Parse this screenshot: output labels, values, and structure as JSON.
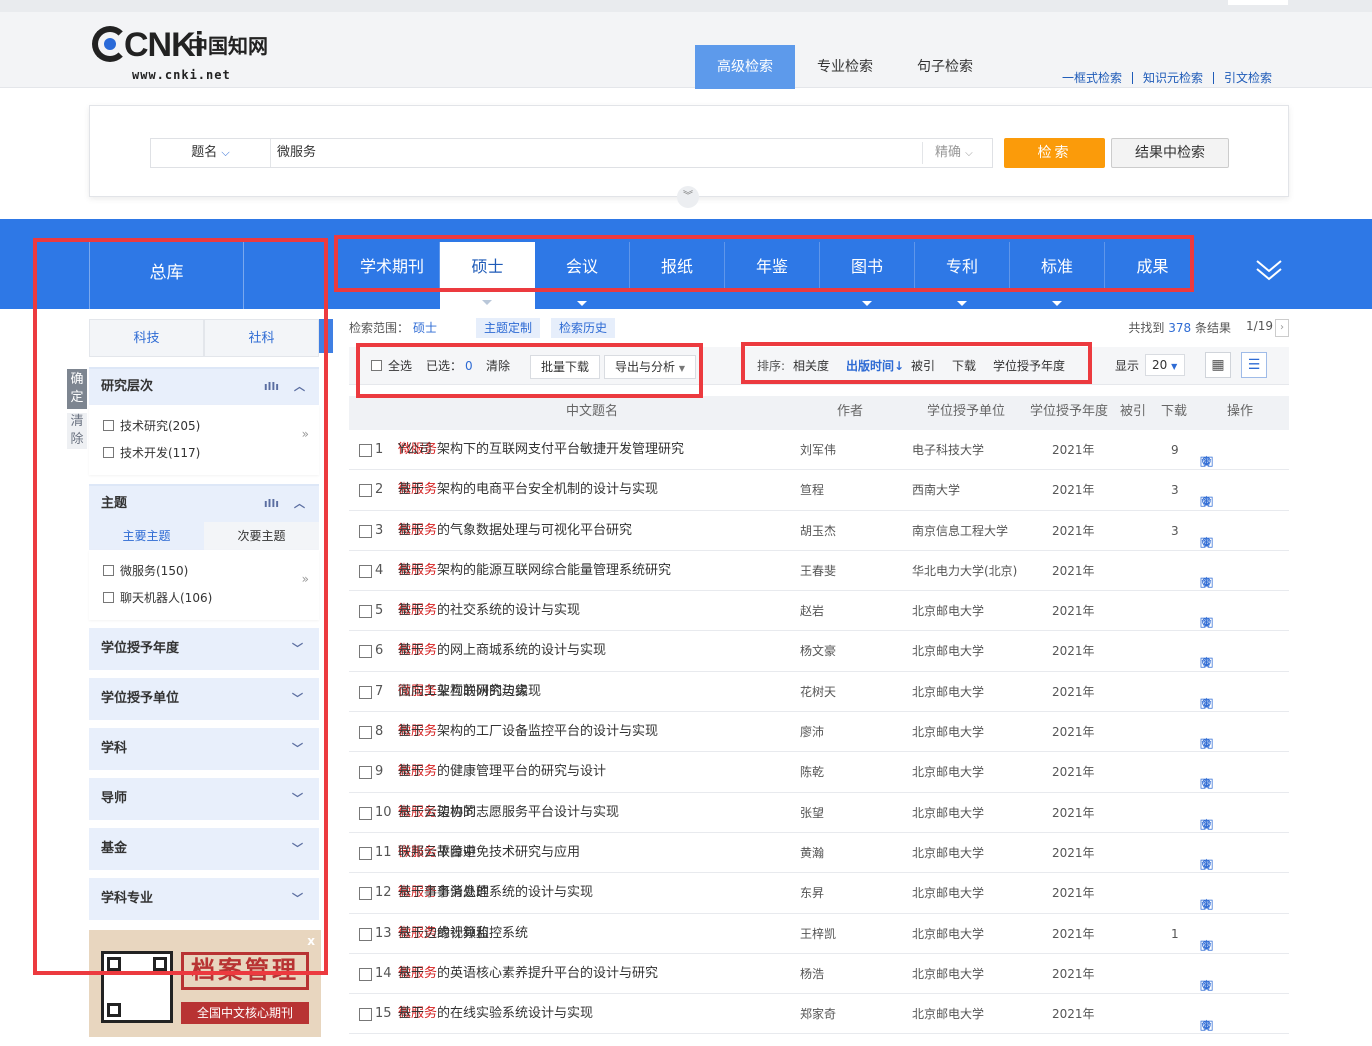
{
  "header": {
    "logo_text": "CNKi",
    "logo_cn": "中国知网",
    "logo_url": "www.cnki.net",
    "search_tabs": [
      "高级检索",
      "专业检索",
      "句子检索"
    ],
    "active_search_tab": 0,
    "top_links": [
      "一框式检索",
      "知识元检索",
      "引文检索"
    ]
  },
  "search": {
    "field": "题名",
    "field_caret": "⌵",
    "query": "微服务",
    "precision": "精确",
    "precision_caret": "⌵",
    "search_button": "检索",
    "refine_button": "结果中检索",
    "expand_icon": "chevron-double-down"
  },
  "db_tabs": {
    "all": "总库",
    "items": [
      "学术期刊",
      "硕士",
      "会议",
      "报纸",
      "年鉴",
      "图书",
      "专利",
      "标准",
      "成果"
    ],
    "active": 1
  },
  "sidebar": {
    "tabs": [
      "科技",
      "社科"
    ],
    "confirm": "确定",
    "clear": "清除",
    "groups": [
      {
        "title": "研究层次",
        "items": [
          "技术研究(205)",
          "技术开发(117)"
        ]
      },
      {
        "title": "主题",
        "subtabs": [
          "主要主题",
          "次要主题"
        ],
        "items": [
          "微服务(150)",
          "聊天机器人(106)"
        ]
      }
    ],
    "collapsed": [
      "学位授予年度",
      "学位授予单位",
      "学科",
      "导师",
      "基金",
      "学科专业"
    ],
    "ad": {
      "title": "档案管理",
      "subtitle": "全国中文核心期刊",
      "close": "x"
    }
  },
  "results": {
    "scope_label": "检索范围：",
    "scope_value": "硕士",
    "tag_topic": "主题定制",
    "tag_history": "检索历史",
    "found_prefix": "共找到",
    "found_count": "378",
    "found_suffix": "条结果",
    "page": "1/19",
    "toolbar": {
      "select_all": "全选",
      "selected_label": "已选：",
      "selected_count": "0",
      "clear": "清除",
      "batch_download": "批量下载",
      "export": "导出与分析",
      "sort_label": "排序:",
      "sort_options": [
        "相关度",
        "出版时间↓",
        "被引",
        "下载",
        "学位授予年度"
      ],
      "sort_active": 1,
      "show_label": "显示",
      "page_size": "20"
    },
    "columns": [
      "中文题名",
      "作者",
      "学位授予单位",
      "学位授予年度",
      "被引",
      "下载",
      "操作"
    ],
    "rows": [
      {
        "n": "1",
        "pre": "Y公司",
        "hl": "微服务",
        "post": "架构下的互联网支付平台敏捷开发管理研究",
        "author": "刘军伟",
        "unit": "电子科技大学",
        "year": "2021年",
        "cite": "",
        "dl": "9"
      },
      {
        "n": "2",
        "pre": "基于",
        "hl": "微服务",
        "post": "架构的电商平台安全机制的设计与实现",
        "author": "笪程",
        "unit": "西南大学",
        "year": "2021年",
        "cite": "",
        "dl": "3"
      },
      {
        "n": "3",
        "pre": "基于",
        "hl": "微服务",
        "post": "的气象数据处理与可视化平台研究",
        "author": "胡玉杰",
        "unit": "南京信息工程大学",
        "year": "2021年",
        "cite": "",
        "dl": "3"
      },
      {
        "n": "4",
        "pre": "基于",
        "hl": "微服务",
        "post": "架构的能源互联网综合能量管理系统研究",
        "author": "王春斐",
        "unit": "华北电力大学(北京)",
        "year": "2021年",
        "cite": "",
        "dl": ""
      },
      {
        "n": "5",
        "pre": "基于",
        "hl": "微服务",
        "post": "的社交系统的设计与实现",
        "author": "赵岩",
        "unit": "北京邮电大学",
        "year": "2021年",
        "cite": "",
        "dl": ""
      },
      {
        "n": "6",
        "pre": "基于",
        "hl": "微服务",
        "post": "的网上商城系统的设计与实现",
        "author": "杨文豪",
        "unit": "北京邮电大学",
        "year": "2021年",
        "cite": "",
        "dl": ""
      },
      {
        "n": "7",
        "pre": "面向工业互联网的边缘",
        "hl": "微服务",
        "post": "架构的研究与实现",
        "author": "花树天",
        "unit": "北京邮电大学",
        "year": "2021年",
        "cite": "",
        "dl": ""
      },
      {
        "n": "8",
        "pre": "基于",
        "hl": "微服务",
        "post": "架构的工厂设备监控平台的设计与实现",
        "author": "廖沛",
        "unit": "北京邮电大学",
        "year": "2021年",
        "cite": "",
        "dl": ""
      },
      {
        "n": "9",
        "pre": "基于",
        "hl": "微服务",
        "post": "的健康管理平台的研究与设计",
        "author": "陈乾",
        "unit": "北京邮电大学",
        "year": "2021年",
        "cite": "",
        "dl": ""
      },
      {
        "n": "10",
        "pre": "基于云边协同",
        "hl": "微服务",
        "post": "架构的志愿服务平台设计与实现",
        "author": "张望",
        "unit": "北京邮电大学",
        "year": "2021年",
        "cite": "",
        "dl": ""
      },
      {
        "n": "11",
        "pre": "联邦云平台中",
        "hl": "微服务",
        "post": "故障避免技术研究与应用",
        "author": "黄瀚",
        "unit": "北京邮电大学",
        "year": "2021年",
        "cite": "",
        "dl": ""
      },
      {
        "n": "12",
        "pre": "基于事务消息的",
        "hl": "微服务",
        "post": "事务处理系统的设计与实现",
        "author": "东昇",
        "unit": "北京邮电大学",
        "year": "2021年",
        "cite": "",
        "dl": ""
      },
      {
        "n": "13",
        "pre": "基于边缘计算和",
        "hl": "微服务",
        "post": "的视频监控系统",
        "author": "王梓凯",
        "unit": "北京邮电大学",
        "year": "2021年",
        "cite": "",
        "dl": "1"
      },
      {
        "n": "14",
        "pre": "基于",
        "hl": "微服务",
        "post": "的英语核心素养提升平台的设计与研究",
        "author": "杨浩",
        "unit": "北京邮电大学",
        "year": "2021年",
        "cite": "",
        "dl": ""
      },
      {
        "n": "15",
        "pre": "基于",
        "hl": "微服务",
        "post": "的在线实验系统设计与实现",
        "author": "郑家奇",
        "unit": "北京邮电大学",
        "year": "2021年",
        "cite": "",
        "dl": ""
      }
    ]
  },
  "colors": {
    "blue_bar": "#2e78e6",
    "accent": "#2e6bd4",
    "search_btn": "#fb9b0a",
    "highlight": "#d42020",
    "annotation": "#ec3a3f"
  }
}
